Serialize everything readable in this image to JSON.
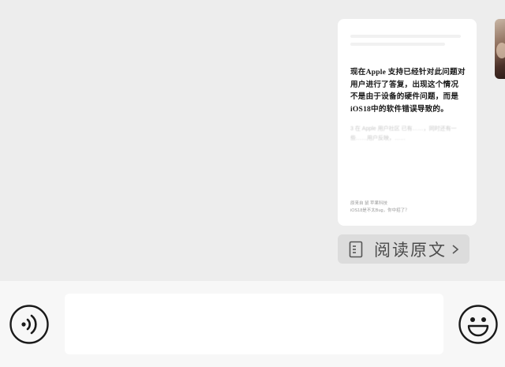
{
  "message": {
    "article_text": "现在Apple 支持已经针对此问题对用户进行了答复，出现这个情况不是由于设备的硬件问题，而是iOS18中的软件错误导致的。",
    "blurred_text": "3 在 Apple 用户社区 已有……，同时还有一些……用户反映，……",
    "meta_line1": "原来自  鼠 苹果科技",
    "meta_line2": "iOS18是不太Bug，你中招了？"
  },
  "read_original": {
    "label": "阅读原文",
    "icon": "document-icon"
  },
  "input": {
    "placeholder": ""
  },
  "icons": {
    "voice": "voice-icon",
    "emoji": "emoji-icon"
  }
}
